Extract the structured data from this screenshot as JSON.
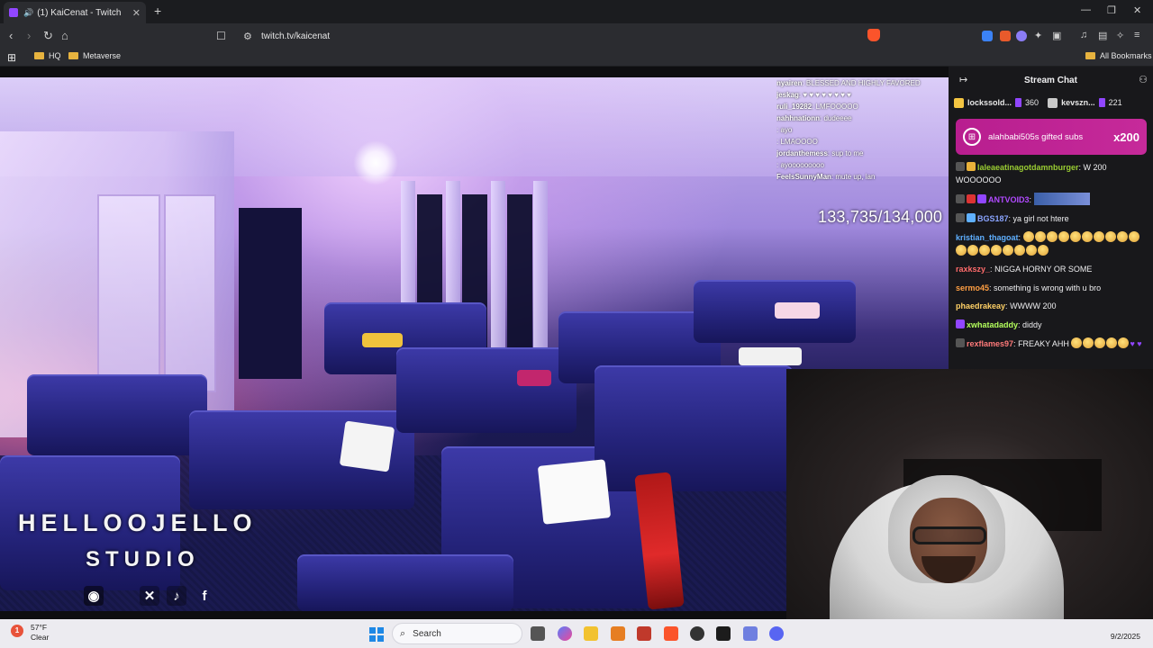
{
  "browser": {
    "tab_title": "(1) KaiCenat - Twitch",
    "new_tab": "+",
    "url": "twitch.tv/kaicenat",
    "bookmarks": [
      {
        "label": "HQ"
      },
      {
        "label": "Metaverse"
      }
    ],
    "all_bookmarks": "All Bookmarks"
  },
  "stream": {
    "overlay_chat": [
      {
        "user": "nyairen",
        "text": "BLESSED AND HIGHLY FAVORED"
      },
      {
        "user": "jeskag",
        "text": "♥ ♥ ♥ ♥ ♥ ♥ ♥ ♥"
      },
      {
        "user": "ruli_19282",
        "text": "LMFOOOOO"
      },
      {
        "user": "nahhnationn",
        "text": "dudeeee"
      },
      {
        "user": "",
        "text": "ayo"
      },
      {
        "user": "",
        "text": "LMAOOOO"
      },
      {
        "user": "jordanthemess",
        "text": "sup to me"
      },
      {
        "user": "",
        "text": "ayooooooooo"
      },
      {
        "user": "FeelsSunnyMan",
        "text": "mute up, ian"
      }
    ],
    "sub_counter": "133,735/134,000",
    "logo_line1": "HELLOOJELLO",
    "logo_line2": "STUDIO",
    "social_f": "f"
  },
  "chat": {
    "title": "Stream Chat",
    "leaders": [
      {
        "name": "lockssold...",
        "count": "360"
      },
      {
        "name": "kevszn...",
        "count": "221"
      }
    ],
    "gift": {
      "text": "alahbabi505s gifted subs",
      "amount": "x200"
    },
    "messages": [
      {
        "user": "laleaeatinagotdamnburger",
        "color": "#9acd32",
        "text": "W 200 WOOOOOO"
      },
      {
        "user": "ANTVOID3",
        "color": "#b14aff",
        "text": ""
      },
      {
        "user": "BGS187",
        "color": "#8aa4ff",
        "text": "ya girl not htere"
      },
      {
        "user": "kristian_thagoat",
        "color": "#5fb0ff",
        "text": ""
      },
      {
        "user": "raxkszy_",
        "color": "#ff6b6b",
        "text": "NIGGA HORNY OR SOME"
      },
      {
        "user": "sermo45",
        "color": "#ff9f43",
        "text": "something is wrong with u bro"
      },
      {
        "user": "phaedrakeay",
        "color": "#ffd166",
        "text": "WWWW 200"
      },
      {
        "user": "xwhatadaddy",
        "color": "#b4ff5c",
        "text": "diddy"
      },
      {
        "user": "rexflames97",
        "color": "#ff7a7a",
        "text": "FREAKY AHH"
      }
    ]
  },
  "taskbar": {
    "weather_temp": "57°F",
    "weather_desc": "Clear",
    "weather_badge": "1",
    "search_placeholder": "Search",
    "date": "9/2/2025"
  },
  "colors": {
    "twitch_purple": "#9146ff",
    "gift_magenta": "#c62a9a",
    "chat_bg": "#18181b"
  }
}
